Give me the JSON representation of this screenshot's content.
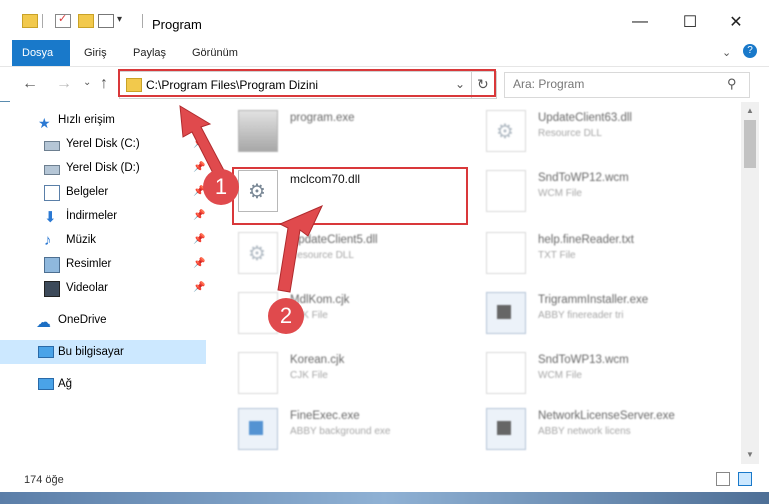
{
  "window": {
    "title": "Program"
  },
  "ribbon": {
    "tabs": [
      "Dosya",
      "Giriş",
      "Paylaş",
      "Görünüm"
    ]
  },
  "nav": {
    "address": "C:\\Program Files\\Program Dizini",
    "search_placeholder": "Ara: Program"
  },
  "sidebar": {
    "items": [
      {
        "label": "Hızlı erişim",
        "icon": "star-icon",
        "pinned": false
      },
      {
        "label": "Yerel Disk (C:)",
        "icon": "drive-icon",
        "pinned": true
      },
      {
        "label": "Yerel Disk (D:)",
        "icon": "drive-icon",
        "pinned": true
      },
      {
        "label": "Belgeler",
        "icon": "documents-icon",
        "pinned": true
      },
      {
        "label": "İndirmeler",
        "icon": "download-icon",
        "pinned": true
      },
      {
        "label": "Müzik",
        "icon": "music-icon",
        "pinned": true
      },
      {
        "label": "Resimler",
        "icon": "pictures-icon",
        "pinned": true
      },
      {
        "label": "Videolar",
        "icon": "videos-icon",
        "pinned": true
      },
      {
        "label": "OneDrive",
        "icon": "cloud-icon",
        "pinned": false
      },
      {
        "label": "Bu bilgisayar",
        "icon": "computer-icon",
        "pinned": false
      },
      {
        "label": "Ağ",
        "icon": "network-icon",
        "pinned": false
      }
    ]
  },
  "files": {
    "left": [
      {
        "name": "program.exe",
        "type": ""
      },
      {
        "name": "mclcom70.dll",
        "type": ""
      },
      {
        "name": "UpdateClient5.dll",
        "type": "Resource DLL"
      },
      {
        "name": "MdlKom.cjk",
        "type": "CJK File"
      },
      {
        "name": "Korean.cjk",
        "type": "CJK File"
      },
      {
        "name": "FineExec.exe",
        "type": "ABBY background exe"
      }
    ],
    "right": [
      {
        "name": "UpdateClient63.dll",
        "type": "Resource DLL"
      },
      {
        "name": "SndToWP12.wcm",
        "type": "WCM File"
      },
      {
        "name": "help.fineReader.txt",
        "type": "TXT File"
      },
      {
        "name": "TrigrammInstaller.exe",
        "type": "ABBY finereader tri"
      },
      {
        "name": "SndToWP13.wcm",
        "type": "WCM File"
      },
      {
        "name": "NetworkLicenseServer.exe",
        "type": "ABBY network licens"
      }
    ]
  },
  "annotations": {
    "step1": "1",
    "step2": "2"
  },
  "status": {
    "count": "174 öğe"
  },
  "colors": {
    "accent": "#1979ca",
    "highlight": "#d9383a",
    "selected": "#cce8ff"
  }
}
